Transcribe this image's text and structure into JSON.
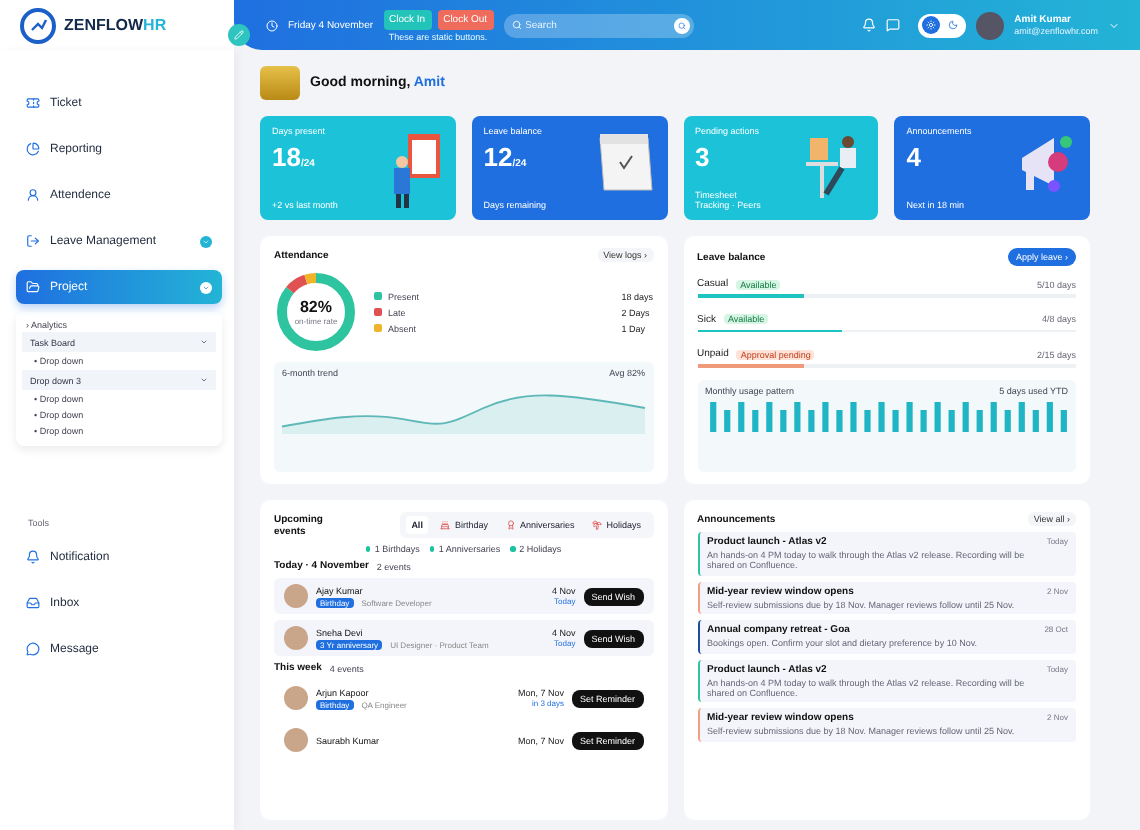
{
  "brand": {
    "name": "ZENFLOW",
    "suffix": "HR"
  },
  "header": {
    "date": "Friday 4 November",
    "clock_in": "Clock In",
    "clock_out": "Clock Out",
    "hint": "These are static buttons.",
    "search": {
      "placeholder": "Search"
    },
    "dark_mode": false,
    "user": {
      "name": "Amit Kumar",
      "email": "amit@zenflowhr.com"
    }
  },
  "sidebar": {
    "items": [
      {
        "label": "Ticket",
        "selected": false,
        "expandable": false
      },
      {
        "label": "Reporting",
        "selected": false,
        "expandable": false
      },
      {
        "label": "Attendence",
        "selected": false,
        "expandable": false
      },
      {
        "label": "Leave Management",
        "selected": false,
        "expandable": true
      },
      {
        "label": "Project",
        "selected": true,
        "expandable": true
      }
    ],
    "submenu": {
      "heading": "› Analytics",
      "groups": [
        {
          "label": "Task Board",
          "children": [
            {
              "label": "• Drop down"
            }
          ]
        },
        {
          "label": "Drop down 3",
          "children": [
            {
              "label": "• Drop down"
            },
            {
              "label": "• Drop down"
            },
            {
              "label": "• Drop down"
            }
          ]
        }
      ]
    },
    "tools_heading": "Tools",
    "tools": [
      {
        "label": "Notification"
      },
      {
        "label": "Inbox"
      },
      {
        "label": "Message"
      }
    ]
  },
  "greeting": {
    "text": "Good morning, ",
    "name": "Amit"
  },
  "stat_cards": [
    {
      "kind": "cyan",
      "label": "Days present",
      "value": "18",
      "total": "/24",
      "note": "+2 vs last month"
    },
    {
      "kind": "blue",
      "label": "Leave balance",
      "value": "12",
      "total": "/24",
      "note": "Days remaining"
    },
    {
      "kind": "cyan",
      "label": "Pending actions",
      "value": "3",
      "note": "Timesheet\nTracking · Peers"
    },
    {
      "kind": "blue",
      "label": "Announcements",
      "value": "4",
      "note": "Next in 18 min"
    }
  ],
  "attendance": {
    "title": "Attendance",
    "link": "View logs ›",
    "rate": "82%",
    "rate_label": "on-time rate",
    "legend": [
      {
        "label": "Present",
        "value": "18 days",
        "color": "#2ec4a0"
      },
      {
        "label": "Late",
        "value": "2 Days",
        "color": "#e05252"
      },
      {
        "label": "Absent",
        "value": "1 Day",
        "color": "#f0b429"
      }
    ],
    "trend_label": "6-month trend",
    "trend_value": "Avg 82%"
  },
  "leave_balance": {
    "title": "Leave balance",
    "button": "Apply leave ›",
    "rows": [
      {
        "name": "Casual",
        "kind": "available",
        "badge": "Available",
        "level": 0.28,
        "reading": "5/10 days"
      },
      {
        "name": "Sick",
        "kind": "available",
        "badge": "Available",
        "level": 0.38,
        "reading": "4/8 days"
      },
      {
        "name": "Unpaid",
        "kind": "pending",
        "badge": "Approval pending",
        "level": 0.28,
        "reading": "2/15 days"
      }
    ],
    "usage_label": "Monthly usage pattern",
    "usage_value": "5 days used YTD"
  },
  "events": {
    "title": "Upcoming events",
    "tabs": [
      {
        "label": "All",
        "selected": true
      },
      {
        "label": "Birthday",
        "selected": false
      },
      {
        "label": "Anniversaries",
        "selected": false
      },
      {
        "label": "Holidays",
        "selected": false
      }
    ],
    "summary": [
      "1 Birthdays",
      "1 Anniversaries",
      "2 Holidays"
    ],
    "groups": [
      {
        "title": "Today · 4 November",
        "count": "2 events",
        "items": [
          {
            "name": "Ajay Kumar",
            "tag": "Birthday",
            "role": "Software Developer",
            "date": "4 Nov",
            "when": "Today",
            "action": "Send Wish",
            "highlighted": true
          },
          {
            "name": "Sneha Devi",
            "tag": "3 Yr anniversary",
            "role": "UI Designer · Product Team",
            "date": "4 Nov",
            "when": "Today",
            "action": "Send Wish",
            "highlighted": true
          }
        ]
      },
      {
        "title": "This week",
        "count": "4 events",
        "items": [
          {
            "name": "Arjun Kapoor",
            "tag": "Birthday",
            "role": "QA Engineer",
            "date": "Mon, 7 Nov",
            "when": "in 3 days",
            "action": "Set Reminder",
            "highlighted": false
          },
          {
            "name": "Saurabh Kumar",
            "date": "Mon, 7 Nov",
            "action": "Set Reminder",
            "highlighted": false
          }
        ]
      }
    ]
  },
  "announcements": {
    "title": "Announcements",
    "link": "View all ›",
    "items": [
      {
        "title": "Product launch - Atlas v2",
        "body": "An hands-on 4 PM today to walk through the Atlas v2 release. Recording will be shared on Confluence.",
        "date": "Today",
        "color": "#2ec4a0"
      },
      {
        "title": "Mid-year review window opens",
        "body": "Self-review submissions due by 18 Nov. Manager reviews follow until 25 Nov.",
        "date": "2 Nov",
        "color": "#f0a080"
      },
      {
        "title": "Annual company retreat - Goa",
        "body": "Bookings open. Confirm your slot and dietary preference by 10 Nov.",
        "date": "28 Oct",
        "color": "#1e4f9c"
      },
      {
        "title": "Product launch - Atlas v2",
        "body": "An hands-on 4 PM today to walk through the Atlas v2 release. Recording will be shared on Confluence.",
        "date": "Today",
        "color": "#2ec4a0"
      },
      {
        "title": "Mid-year review window opens",
        "body": "Self-review submissions due by 18 Nov. Manager reviews follow until 25 Nov.",
        "date": "2 Nov",
        "color": "#f0a080"
      }
    ]
  }
}
